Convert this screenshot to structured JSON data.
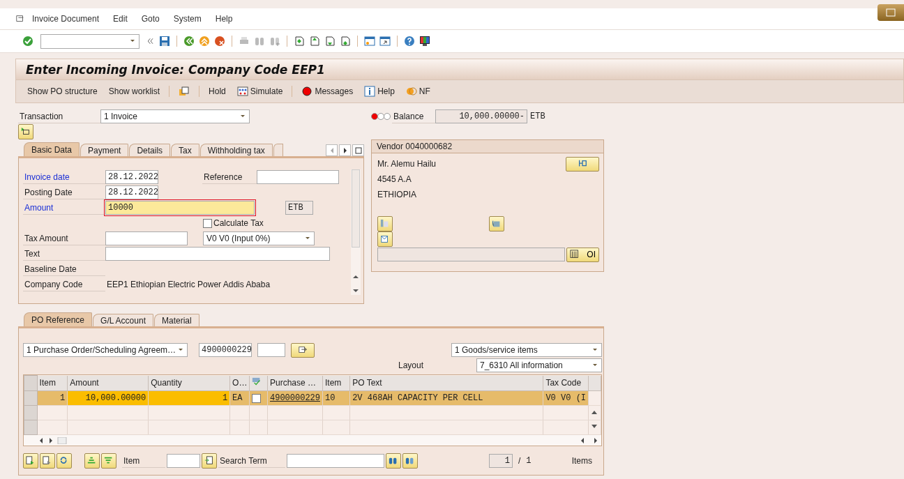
{
  "menu_bar": {
    "items": [
      "Invoice Document",
      "Edit",
      "Goto",
      "System",
      "Help"
    ]
  },
  "title": "Enter Incoming Invoice: Company Code EEP1",
  "app_toolbar": [
    {
      "kind": "text",
      "label": "Show PO structure"
    },
    {
      "kind": "text",
      "label": "Show worklist"
    },
    {
      "kind": "icon"
    },
    {
      "kind": "text",
      "label": "Hold"
    },
    {
      "kind": "icon_text",
      "label": "Simulate"
    },
    {
      "kind": "icon_text",
      "label": "Messages"
    },
    {
      "kind": "icon_text",
      "label": "Help"
    },
    {
      "kind": "icon_text",
      "label": "NF"
    }
  ],
  "transaction": {
    "label": "Transaction",
    "value": "1 Invoice"
  },
  "balance": {
    "label": "Balance",
    "value": "10,000.00000-",
    "currency": "ETB",
    "status_light": {
      "red": true,
      "yellow": false,
      "green": false
    }
  },
  "tabs": [
    {
      "label": "Basic Data",
      "selected": true
    },
    {
      "label": "Payment",
      "selected": false
    },
    {
      "label": "Details",
      "selected": false
    },
    {
      "label": "Tax",
      "selected": false
    },
    {
      "label": "Withholding tax",
      "selected": false
    }
  ],
  "basic_data": {
    "invoice_date": {
      "label": "Invoice date",
      "value": "28.12.2022",
      "link": true
    },
    "reference": {
      "label": "Reference"
    },
    "posting_date": {
      "label": "Posting Date",
      "value": "28.12.2022",
      "link": false
    },
    "amount": {
      "label": "Amount",
      "value": "10000",
      "link": true,
      "focused": true
    },
    "currency": "ETB",
    "calculate_tax": {
      "label": "Calculate Tax",
      "checked": false
    },
    "tax_amount": {
      "label": "Tax Amount"
    },
    "tax_code": {
      "value": "V0 V0 (Input 0%)"
    },
    "text": {
      "label": "Text"
    },
    "baseline_date": {
      "label": "Baseline Date"
    },
    "company_code": {
      "label": "Company Code",
      "value": "EEP1 Ethiopian Electric Power Addis Ababa"
    }
  },
  "vendor": {
    "title": "Vendor 0040000682",
    "address": [
      "Mr. Alemu Hailu",
      "4545 A.A",
      "ETHIOPIA"
    ],
    "oi_button": "OI"
  },
  "po_tabs": [
    {
      "label": "PO Reference",
      "selected": true
    },
    {
      "label": "G/L Account",
      "selected": false
    },
    {
      "label": "Material",
      "selected": false
    }
  ],
  "po_reference": {
    "doc_type": "1 Purchase Order/Scheduling Agreem…",
    "po_number": "4900000229",
    "items_type": "1 Goods/service items",
    "layout": {
      "label": "Layout",
      "value": "7_6310 All information"
    }
  },
  "table": {
    "columns": [
      "Item",
      "Amount",
      "Quantity",
      "O…",
      "Purchase …",
      "Item",
      "PO Text",
      "Tax Code"
    ],
    "rows": [
      {
        "cells": [
          "1",
          "10,000.00000",
          "1",
          "EA",
          "4900000229",
          "10",
          "2V 468AH CAPACITY PER CELL",
          "V0  V0  (I"
        ],
        "checked": false,
        "selected": true
      }
    ]
  },
  "footer": {
    "item_label": "Item",
    "search_label": "Search Term",
    "page": "1",
    "separator": "/",
    "total": "1",
    "items_label": "Items"
  }
}
